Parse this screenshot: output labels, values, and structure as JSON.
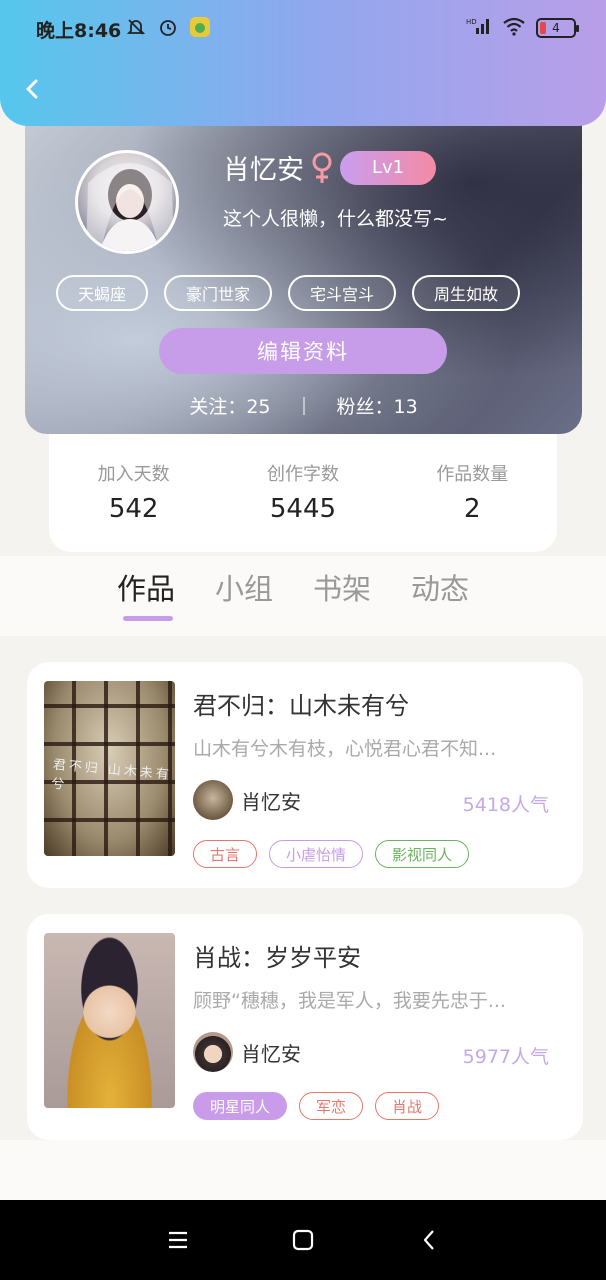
{
  "status_bar": {
    "time": "晚上8:46",
    "battery": "4",
    "icons": [
      "bell-off-icon",
      "alarm-icon",
      "app-notification-icon",
      "hd-signal-icon",
      "wifi-icon",
      "battery-icon"
    ]
  },
  "header": {
    "back_icon": "chevron-left-icon"
  },
  "profile": {
    "name": "肖忆安",
    "gender_icon": "female-icon",
    "level": "Lv1",
    "bio": "这个人很懒，什么都没写~",
    "tags": [
      "天蝎座",
      "豪门世家",
      "宅斗宫斗",
      "周生如故"
    ],
    "edit_label": "编辑资料",
    "following_label": "关注：25",
    "followers_label": "粉丝：13"
  },
  "stats": [
    {
      "label": "加入天数",
      "value": "542"
    },
    {
      "label": "创作字数",
      "value": "5445"
    },
    {
      "label": "作品数量",
      "value": "2"
    }
  ],
  "tabs": [
    {
      "label": "作品",
      "active": true
    },
    {
      "label": "小组",
      "active": false
    },
    {
      "label": "书架",
      "active": false
    },
    {
      "label": "动态",
      "active": false
    }
  ],
  "works": [
    {
      "title": "君不归：山木未有兮",
      "summary": "山木有兮木有枝，心悦君心君不知...",
      "author": "肖忆安",
      "popularity": "5418人气",
      "cover_text": "君不归 山木未有兮",
      "genres": [
        {
          "label": "古言",
          "style": "red"
        },
        {
          "label": "小虐怡情",
          "style": "purple"
        },
        {
          "label": "影视同人",
          "style": "green"
        }
      ]
    },
    {
      "title": "肖战：岁岁平安",
      "summary": "顾野“穗穗，我是军人，我要先忠于...",
      "author": "肖忆安",
      "popularity": "5977人气",
      "cover_text": "",
      "genres": [
        {
          "label": "明星同人",
          "style": "filled"
        },
        {
          "label": "军恋",
          "style": "red"
        },
        {
          "label": "肖战",
          "style": "red"
        }
      ]
    }
  ],
  "nav": {
    "icons": [
      "menu-icon",
      "home-square-icon",
      "back-triangle-icon"
    ]
  }
}
